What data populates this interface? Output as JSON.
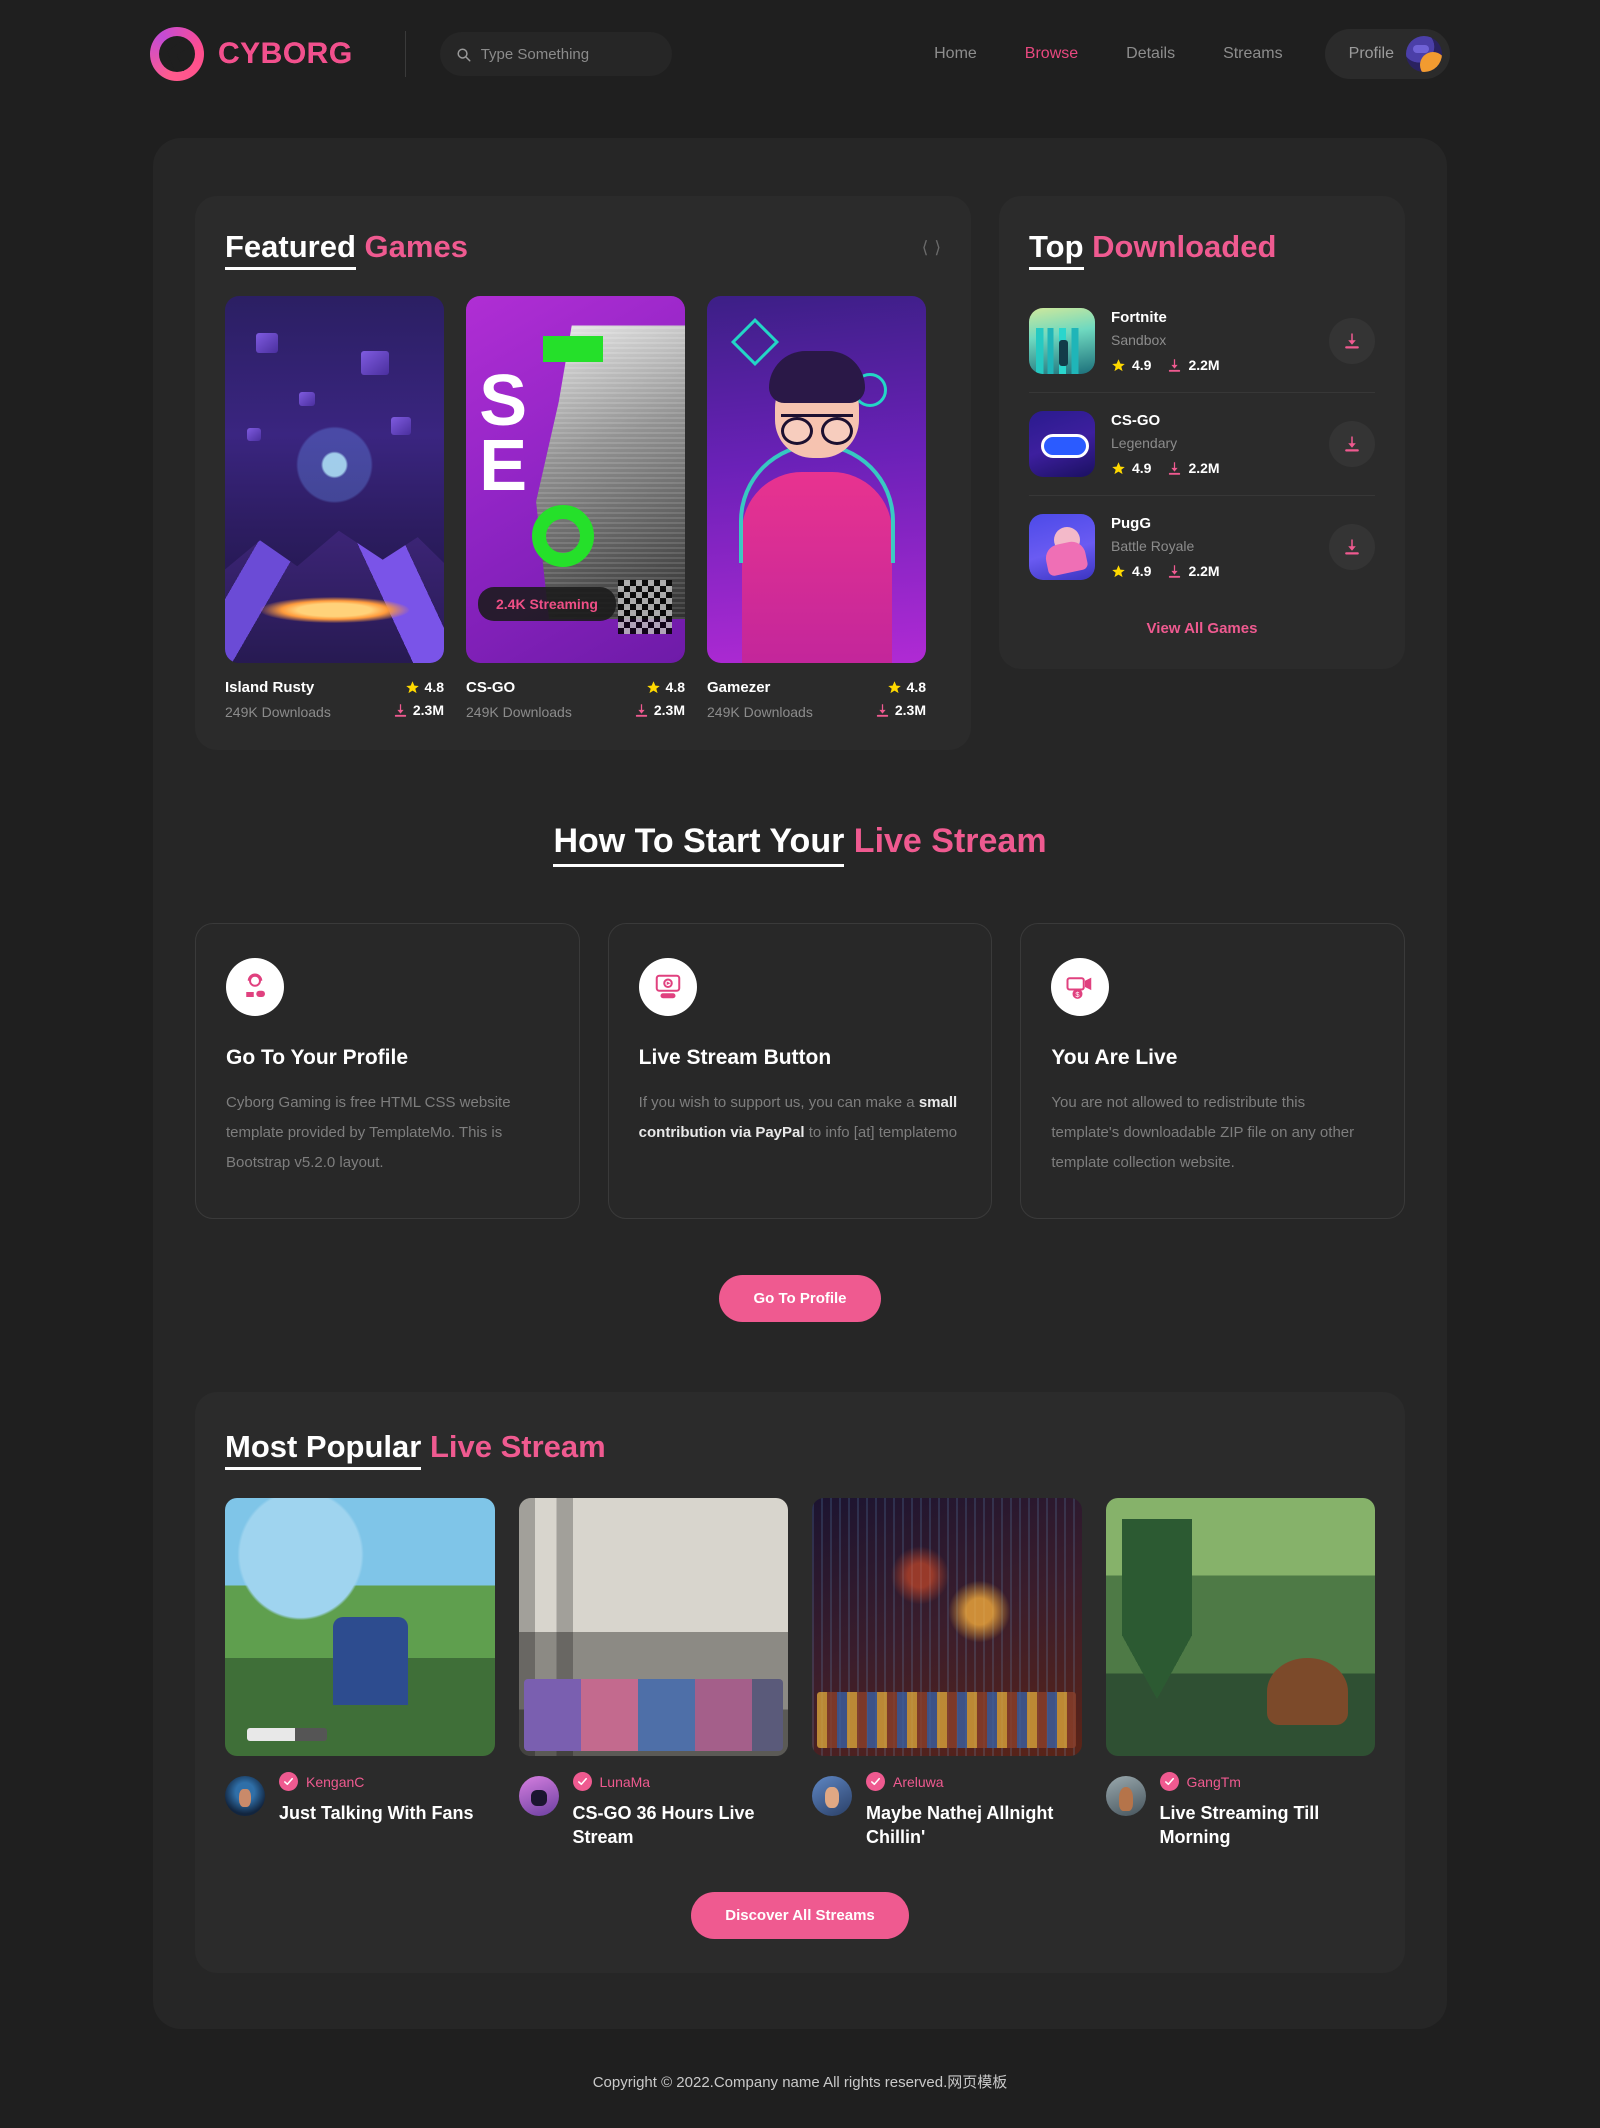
{
  "brand": {
    "name": "CYBORG",
    "logo_icon": "cyborg-logo-icon"
  },
  "search": {
    "placeholder": "Type Something",
    "value": "",
    "icon": "search-icon"
  },
  "nav": {
    "links": [
      {
        "label": "Home",
        "active": false
      },
      {
        "label": "Browse",
        "active": true
      },
      {
        "label": "Details",
        "active": false
      },
      {
        "label": "Streams",
        "active": false
      }
    ],
    "profile": {
      "label": "Profile",
      "avatar_icon": "profile-avatar"
    }
  },
  "featured": {
    "title_white": "Featured",
    "title_accent": "Games",
    "prev_icon": "chevron-left-icon",
    "next_icon": "chevron-right-icon",
    "games": [
      {
        "name": "Island Rusty",
        "downloads_label": "249K Downloads",
        "rating": "4.8",
        "download_count": "2.3M",
        "badge": ""
      },
      {
        "name": "CS-GO",
        "downloads_label": "249K Downloads",
        "rating": "4.8",
        "download_count": "2.3M",
        "badge": "2.4K Streaming"
      },
      {
        "name": "Gamezer",
        "downloads_label": "249K Downloads",
        "rating": "4.8",
        "download_count": "2.3M",
        "badge": ""
      }
    ]
  },
  "top_downloaded": {
    "title_white": "Top",
    "title_accent": "Downloaded",
    "items": [
      {
        "name": "Fortnite",
        "category": "Sandbox",
        "rating": "4.9",
        "downloads": "2.2M"
      },
      {
        "name": "CS-GO",
        "category": "Legendary",
        "rating": "4.9",
        "downloads": "2.2M"
      },
      {
        "name": "PugG",
        "category": "Battle Royale",
        "rating": "4.9",
        "downloads": "2.2M"
      }
    ],
    "view_all": "View All Games"
  },
  "how_to": {
    "title_white": "How To Start Your",
    "title_accent": "Live Stream",
    "cards": [
      {
        "icon": "gamer-headset-icon",
        "heading": "Go To Your Profile",
        "body_pre": "Cyborg Gaming is free HTML CSS website template provided by TemplateMo. This is Bootstrap v5.2.0 layout.",
        "body_strong": "",
        "body_post": ""
      },
      {
        "icon": "live-stream-monitor-icon",
        "heading": "Live Stream Button",
        "body_pre": "If you wish to support us, you can make a ",
        "body_strong": "small contribution via PayPal",
        "body_post": " to info [at] templatemo"
      },
      {
        "icon": "video-money-icon",
        "heading": "You Are Live",
        "body_pre": "You are not allowed to redistribute this template's downloadable ZIP file on any other template collection website.",
        "body_strong": "",
        "body_post": ""
      }
    ],
    "cta": "Go To Profile"
  },
  "popular": {
    "title_white": "Most Popular",
    "title_accent": "Live Stream",
    "streams": [
      {
        "user": "KenganC",
        "title": "Just Talking With Fans",
        "verified_icon": "verified-check-icon"
      },
      {
        "user": "LunaMa",
        "title": "CS-GO 36 Hours Live Stream",
        "verified_icon": "verified-check-icon"
      },
      {
        "user": "Areluwa",
        "title": "Maybe Nathej Allnight Chillin'",
        "verified_icon": "verified-check-icon"
      },
      {
        "user": "GangTm",
        "title": "Live Streaming Till Morning",
        "verified_icon": "verified-check-icon"
      }
    ],
    "cta": "Discover All Streams"
  },
  "footer": {
    "copyright": "Copyright © 2022.Company name All rights reserved.网页模板"
  },
  "colors": {
    "accent_pink": "#ef5a90",
    "brand_pink": "#f2508d",
    "star_yellow": "#ffd900",
    "page_bg": "#1f1f1f",
    "panel_bg": "#2b2b2b"
  }
}
